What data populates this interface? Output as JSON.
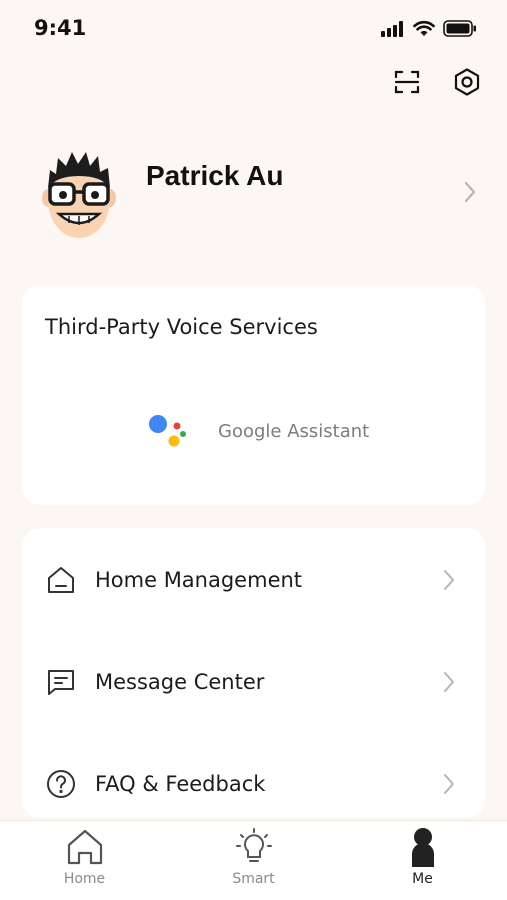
{
  "status_bar": {
    "time": "9:41"
  },
  "profile": {
    "name": "Patrick Au"
  },
  "voice_services": {
    "title": "Third-Party Voice Services",
    "assistant_label": "Google Assistant",
    "colors": {
      "blue": "#4285f4",
      "red": "#ea4335",
      "yellow": "#fbbc05",
      "green": "#34a853"
    }
  },
  "menu": {
    "items": [
      {
        "label": "Home Management",
        "icon": "house-icon"
      },
      {
        "label": "Message Center",
        "icon": "message-icon"
      },
      {
        "label": "FAQ & Feedback",
        "icon": "question-icon"
      }
    ]
  },
  "tab_bar": {
    "tabs": [
      {
        "label": "Home",
        "icon": "house-icon",
        "active": false
      },
      {
        "label": "Smart",
        "icon": "lightbulb-icon",
        "active": false
      },
      {
        "label": "Me",
        "icon": "person-icon",
        "active": true
      }
    ]
  }
}
